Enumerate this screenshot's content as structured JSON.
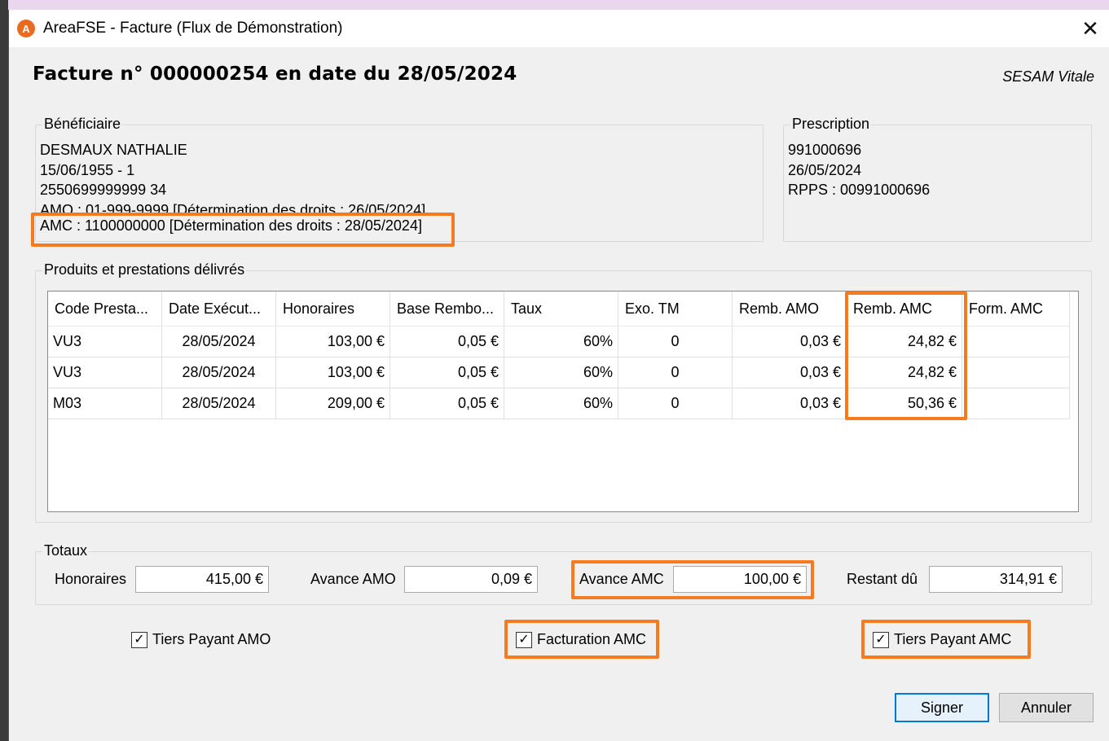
{
  "window": {
    "app_icon_letter": "A",
    "title": "AreaFSE - Facture (Flux de Démonstration)",
    "close_glyph": "✕"
  },
  "invoice": {
    "title": "Facture n° 000000254 en date du 28/05/2024",
    "mode": "SESAM Vitale"
  },
  "beneficiary": {
    "legend": "Bénéficiaire",
    "name": "DESMAUX NATHALIE",
    "birth": "15/06/1955 - 1",
    "nir": "2550699999999 34",
    "amo": "AMO : 01-999-9999 [Détermination des droits : 26/05/2024]",
    "amc": "AMC : 1100000000 [Détermination des droits : 28/05/2024]"
  },
  "prescription": {
    "legend": "Prescription",
    "number": "991000696",
    "date": "26/05/2024",
    "rpps": "RPPS : 00991000696"
  },
  "products": {
    "legend": "Produits et prestations délivrés",
    "columns": [
      "Code Presta...",
      "Date Exécut...",
      "Honoraires",
      "Base Rembo...",
      "Taux",
      "Exo. TM",
      "Remb. AMO",
      "Remb. AMC",
      "Form. AMC"
    ],
    "rows": [
      [
        "VU3",
        "28/05/2024",
        "103,00 €",
        "0,05 €",
        "60%",
        "0",
        "0,03 €",
        "24,82 €",
        ""
      ],
      [
        "VU3",
        "28/05/2024",
        "103,00 €",
        "0,05 €",
        "60%",
        "0",
        "0,03 €",
        "24,82 €",
        ""
      ],
      [
        "M03",
        "28/05/2024",
        "209,00 €",
        "0,05 €",
        "60%",
        "0",
        "0,03 €",
        "50,36 €",
        ""
      ]
    ]
  },
  "totals": {
    "legend": "Totaux",
    "honoraires_label": "Honoraires",
    "honoraires_value": "415,00 €",
    "avance_amo_label": "Avance AMO",
    "avance_amo_value": "0,09 €",
    "avance_amc_label": "Avance AMC",
    "avance_amc_value": "100,00 €",
    "restant_label": "Restant dû",
    "restant_value": "314,91 €"
  },
  "options": {
    "tiers_payant_amo": {
      "label": "Tiers Payant AMO",
      "checked": true
    },
    "facturation_amc": {
      "label": "Facturation AMC",
      "checked": true
    },
    "tiers_payant_amc": {
      "label": "Tiers Payant AMC",
      "checked": true
    }
  },
  "buttons": {
    "sign": "Signer",
    "cancel": "Annuler"
  },
  "colors": {
    "highlight": "#f47b20",
    "app_icon": "#e96b21",
    "primary_button_border": "#0078d7"
  }
}
